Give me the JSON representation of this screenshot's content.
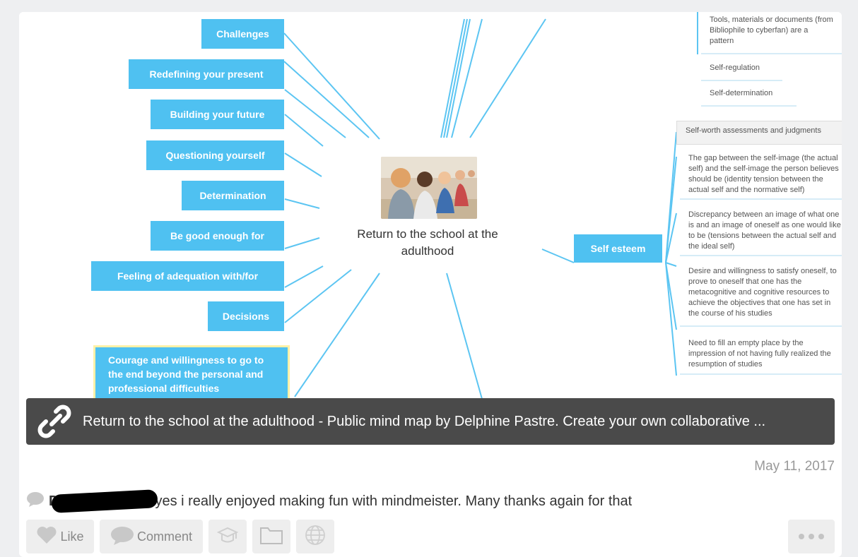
{
  "mindmap": {
    "center_title": "Return to the school at the adulthood",
    "left_nodes": [
      "Challenges",
      "Redefining your present",
      "Building your future",
      "Questioning yourself",
      "Determination",
      "Be good enough for",
      "Feeling of adequation with/for",
      "Decisions"
    ],
    "left_multiline_node": "Courage and willingness to go to the end beyond the personal and professional difficulties",
    "top_right_items": [
      "Tools, materials or documents (from Bibliophile to cyberfan) are a pattern",
      "Self-regulation",
      "Self-determination"
    ],
    "self_esteem_label": "Self esteem",
    "self_esteem_items": [
      "Self-worth assessments and judgments",
      "The gap between the self-image (the actual self) and the self-image the person believes should be (identity tension between the actual self and the normative self)",
      "Discrepancy between an image of what one is and an image of oneself as one would like to be (tensions between the actual self and the ideal self)",
      "Desire and willingness to satisfy oneself, to prove to oneself that one has the metacognitive and cognitive resources to achieve the objectives that one has set in the course of his studies",
      "Need to fill an empty place by the impression of not having fully realized the resumption of studies"
    ]
  },
  "link_preview": {
    "text": "Return to the school at the adulthood - Public mind map by Delphine Pastre. Create your own collaborative ..."
  },
  "post": {
    "date": "May 11, 2017",
    "author_initial": "D",
    "comment_text": "yes i really enjoyed making fun with mindmeister. Many thanks again for that"
  },
  "actions": {
    "like_label": "Like",
    "comment_label": "Comment"
  },
  "colors": {
    "node_blue": "#4fc1f1",
    "highlight_border": "#fff1a8",
    "link_bar": "#4a4a4a"
  }
}
